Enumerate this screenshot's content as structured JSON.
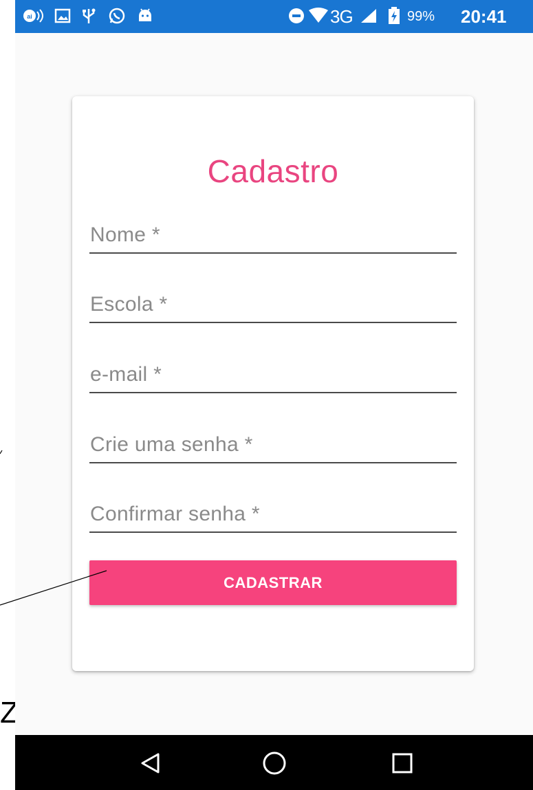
{
  "status_bar": {
    "network": "3G",
    "battery_percent": "99%",
    "time": "20:41",
    "icons": [
      "cast-icon",
      "image-icon",
      "usb-icon",
      "whatsapp-icon",
      "android-icon",
      "do-not-disturb-icon",
      "wifi-icon",
      "signal-icon",
      "battery-charging-icon"
    ],
    "background_color": "#1976d2"
  },
  "form": {
    "title": "Cadastro",
    "title_color": "#e94580",
    "fields": [
      {
        "placeholder": "Nome *"
      },
      {
        "placeholder": "Escola *"
      },
      {
        "placeholder": "e-mail *"
      },
      {
        "placeholder": "Crie uma senha *"
      },
      {
        "placeholder": "Confirmar senha *"
      }
    ],
    "submit_label": "CADASTRAR",
    "submit_color": "#f6437d"
  },
  "annotation": {
    "letter": "Z"
  },
  "nav_bar": {
    "icons": [
      "back-icon",
      "home-icon",
      "recents-icon"
    ]
  }
}
